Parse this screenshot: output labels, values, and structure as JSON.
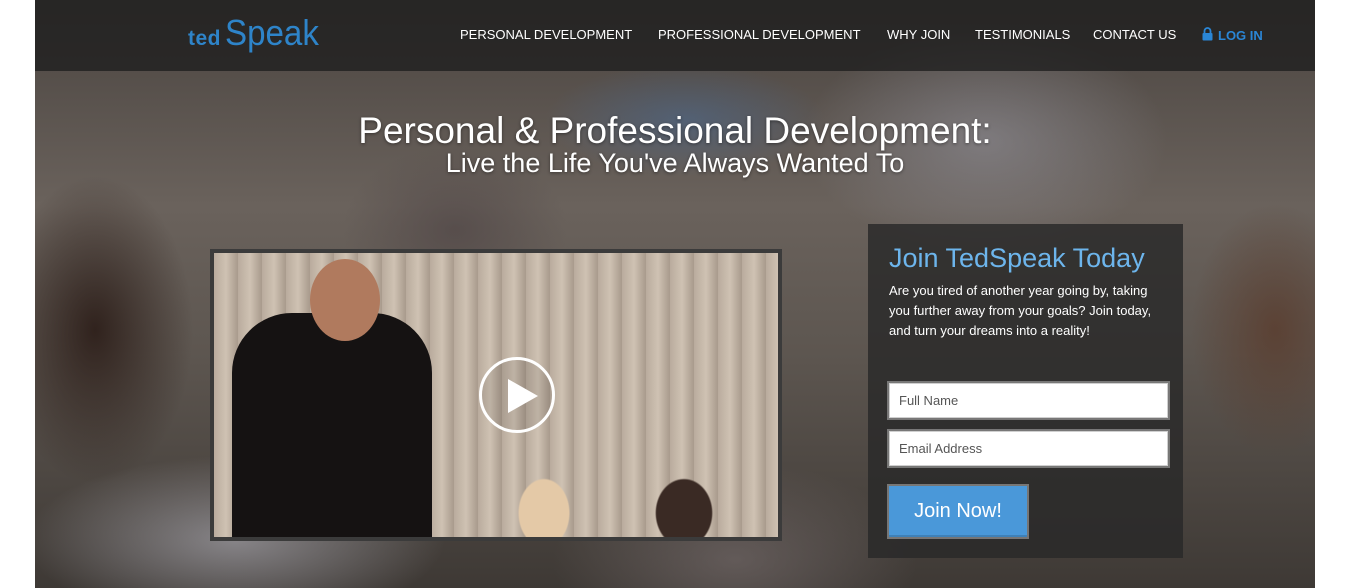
{
  "brand": {
    "logo_small": "ted",
    "logo_large": "Speak",
    "color": "#2e84c9"
  },
  "nav": {
    "items": [
      {
        "label": "PERSONAL DEVELOPMENT"
      },
      {
        "label": "PROFESSIONAL DEVELOPMENT"
      },
      {
        "label": "WHY JOIN"
      },
      {
        "label": "TESTIMONIALS"
      },
      {
        "label": "CONTACT US"
      }
    ],
    "login": {
      "label": "LOG IN",
      "icon": "lock-icon",
      "color": "#2a86d6"
    }
  },
  "hero": {
    "title": "Personal & Professional Development:",
    "subtitle": "Live the Life You've Always Wanted To"
  },
  "video": {
    "icon": "play-icon"
  },
  "signup": {
    "title": "Join TedSpeak Today",
    "title_color": "#6db5ec",
    "description": "Are you tired of another year going by, taking you further away from your goals? Join today, and turn your dreams into a reality!",
    "name_placeholder": "Full Name",
    "email_placeholder": "Email Address",
    "button_label": "Join Now!",
    "button_color": "#4a98d9"
  }
}
